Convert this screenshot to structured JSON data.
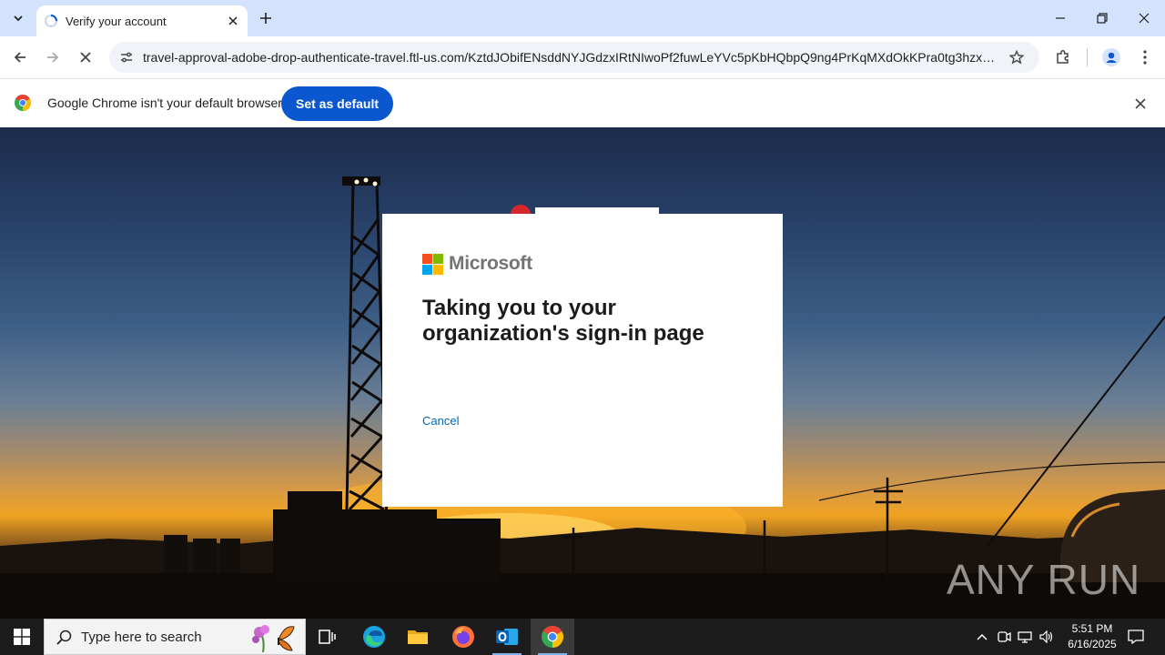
{
  "browser": {
    "tab": {
      "title": "Verify your account"
    },
    "url": "travel-approval-adobe-drop-authenticate-travel.ftl-us.com/KztdJObifENsddNYJGdzxIRtNIwoPf2fuwLeYVc5pKbHQbpQ9ng4PrKqMXdOkKPra0tg3hzxEy...",
    "infobar": {
      "message": "Google Chrome isn't your default browser",
      "button_label": "Set as default"
    }
  },
  "page": {
    "brand": "Microsoft",
    "heading": "Taking you to your organization's sign-in page",
    "cancel_label": "Cancel",
    "brand_colors": [
      "#f25022",
      "#7fba00",
      "#00a4ef",
      "#ffb900"
    ],
    "watermark": "ANY RUN"
  },
  "taskbar": {
    "search_placeholder": "Type here to search",
    "time": "5:51 PM",
    "date": "6/16/2025",
    "pinned": [
      "task-view-icon",
      "edge-icon",
      "file-explorer-icon",
      "firefox-icon",
      "outlook-icon",
      "chrome-icon"
    ]
  }
}
